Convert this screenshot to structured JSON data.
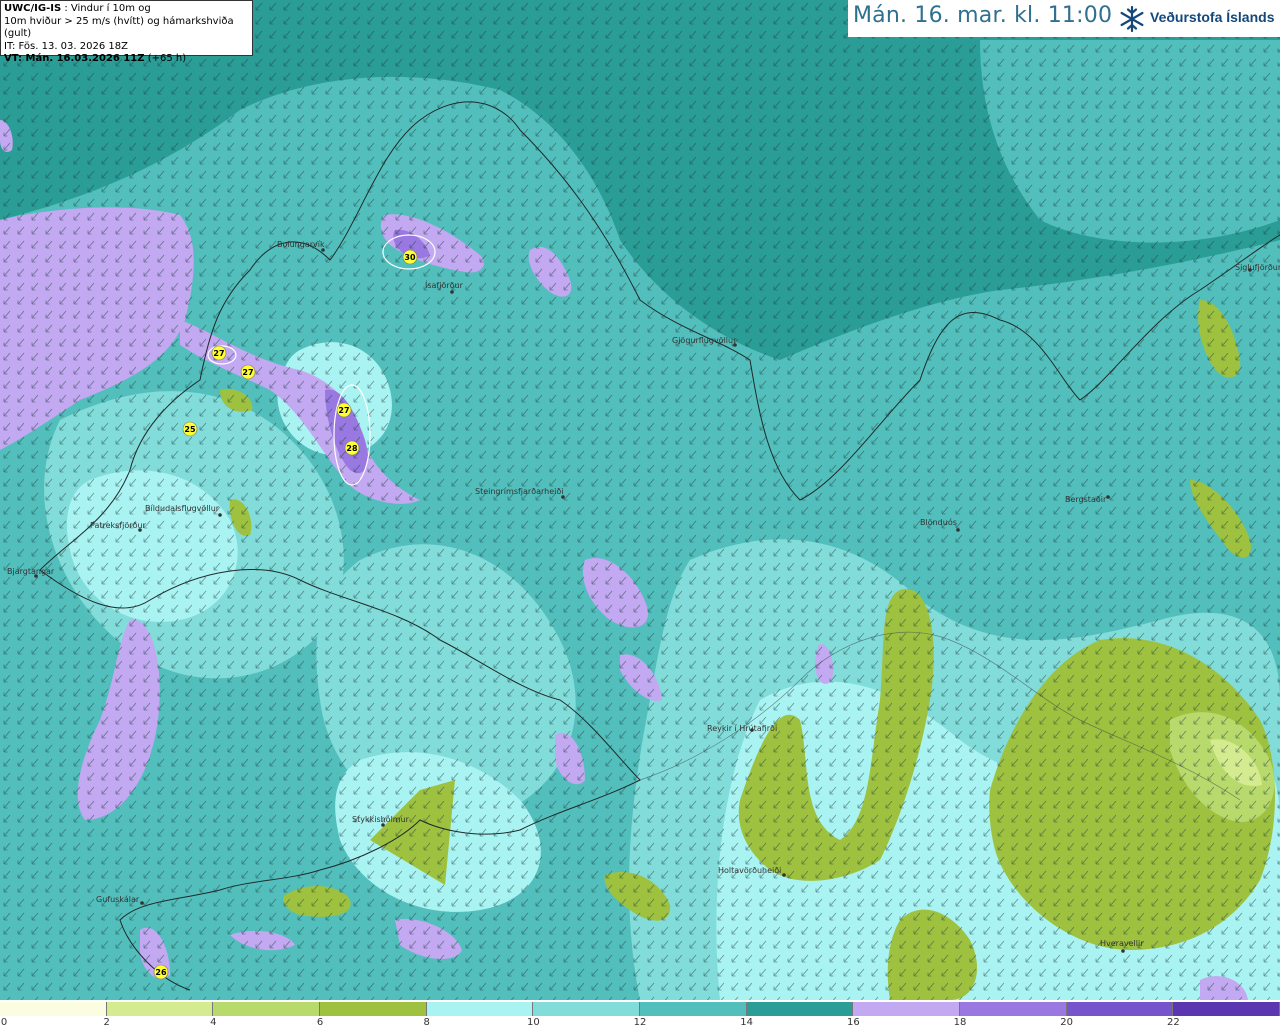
{
  "info_box": {
    "product": "UWC/IG-IS",
    "line1_rest": ": Vindur í 10m og",
    "line2": "10m hviður > 25 m/s (hvítt) og hámarkshviða (gult)",
    "line3": "IT: Fös. 13. 03. 2026 18Z",
    "line4_bold": "VT: Mán. 16.03.2026 11Z",
    "line4_rest": "(+65 h)"
  },
  "header": {
    "date_time": "Mán. 16. mar. kl. 11:00",
    "logo_text": "Veðurstofa Íslands",
    "logo_icon": "snowflake-icon"
  },
  "colors": {
    "sea": "#2a9d96",
    "land_outline": "#1e2a2a",
    "gust_circle": "#ffffff",
    "gust_marker": "#ffff33"
  },
  "legend": {
    "bins": [
      "#fafde0",
      "#d4ec8f",
      "#b8d96c",
      "#9ec23f",
      "#aaf3f3",
      "#82dcda",
      "#52bfbc",
      "#2a9d96",
      "#c3a8f2",
      "#9a78e2",
      "#7654cc",
      "#5a36b0"
    ],
    "labels": [
      "0",
      "2",
      "4",
      "6",
      "8",
      "10",
      "12",
      "14",
      "16",
      "18",
      "20",
      "22"
    ]
  },
  "places": [
    {
      "name": "Bolungarvík"
    },
    {
      "name": "Ísafjörður"
    },
    {
      "name": "Gjögurflugvöllur"
    },
    {
      "name": "Siglufjörður"
    },
    {
      "name": "Patreksfjörður"
    },
    {
      "name": "Bíldudalsflugvöllur"
    },
    {
      "name": "Bjargtangar"
    },
    {
      "name": "Steingrímsfjarðarheiði"
    },
    {
      "name": "Blönduós"
    },
    {
      "name": "Bergstaðir"
    },
    {
      "name": "Reykir í Hrútafirði"
    },
    {
      "name": "Stykkishólmur"
    },
    {
      "name": "Holtavörðuheiði"
    },
    {
      "name": "Gufuskálar"
    },
    {
      "name": "Hveravellir"
    }
  ],
  "gusts": [
    30,
    27,
    27,
    27,
    28,
    25,
    26
  ]
}
